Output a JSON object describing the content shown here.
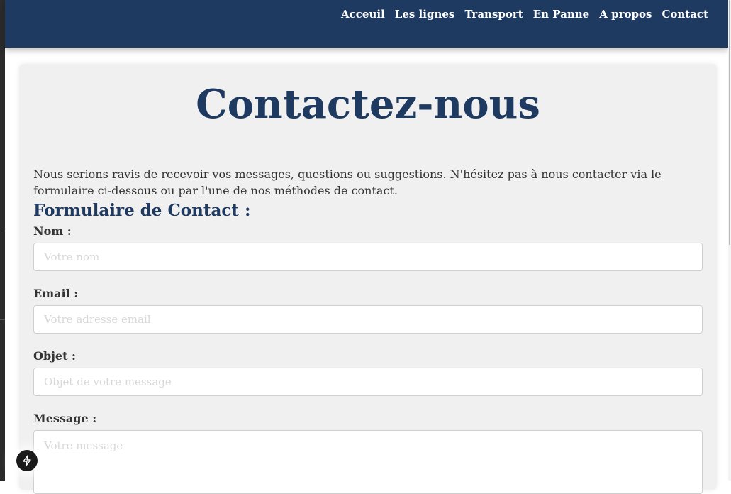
{
  "nav": {
    "links": [
      {
        "label": "Acceuil"
      },
      {
        "label": "Les lignes"
      },
      {
        "label": "Transport"
      },
      {
        "label": "En Panne"
      },
      {
        "label": "A propos"
      },
      {
        "label": "Contact"
      }
    ]
  },
  "main": {
    "title": "Contactez-nous",
    "intro": "Nous serions ravis de recevoir vos messages, questions ou suggestions. N'hésitez pas à nous contacter via le formulaire ci-dessous ou par l'une de nos méthodes de contact.",
    "form_heading": "Formulaire de Contact :"
  },
  "form": {
    "name_label": "Nom :",
    "name_placeholder": "Votre nom",
    "email_label": "Email :",
    "email_placeholder": "Votre adresse email",
    "subject_label": "Objet :",
    "subject_placeholder": "Objet de votre message",
    "message_label": "Message :",
    "message_placeholder": "Votre message"
  },
  "colors": {
    "nav_background": "#1f3a60",
    "title_color": "#1f3a60",
    "card_background": "#f0f0f0"
  },
  "icons": {
    "devtools_badge": "lightning-bolt-icon"
  }
}
